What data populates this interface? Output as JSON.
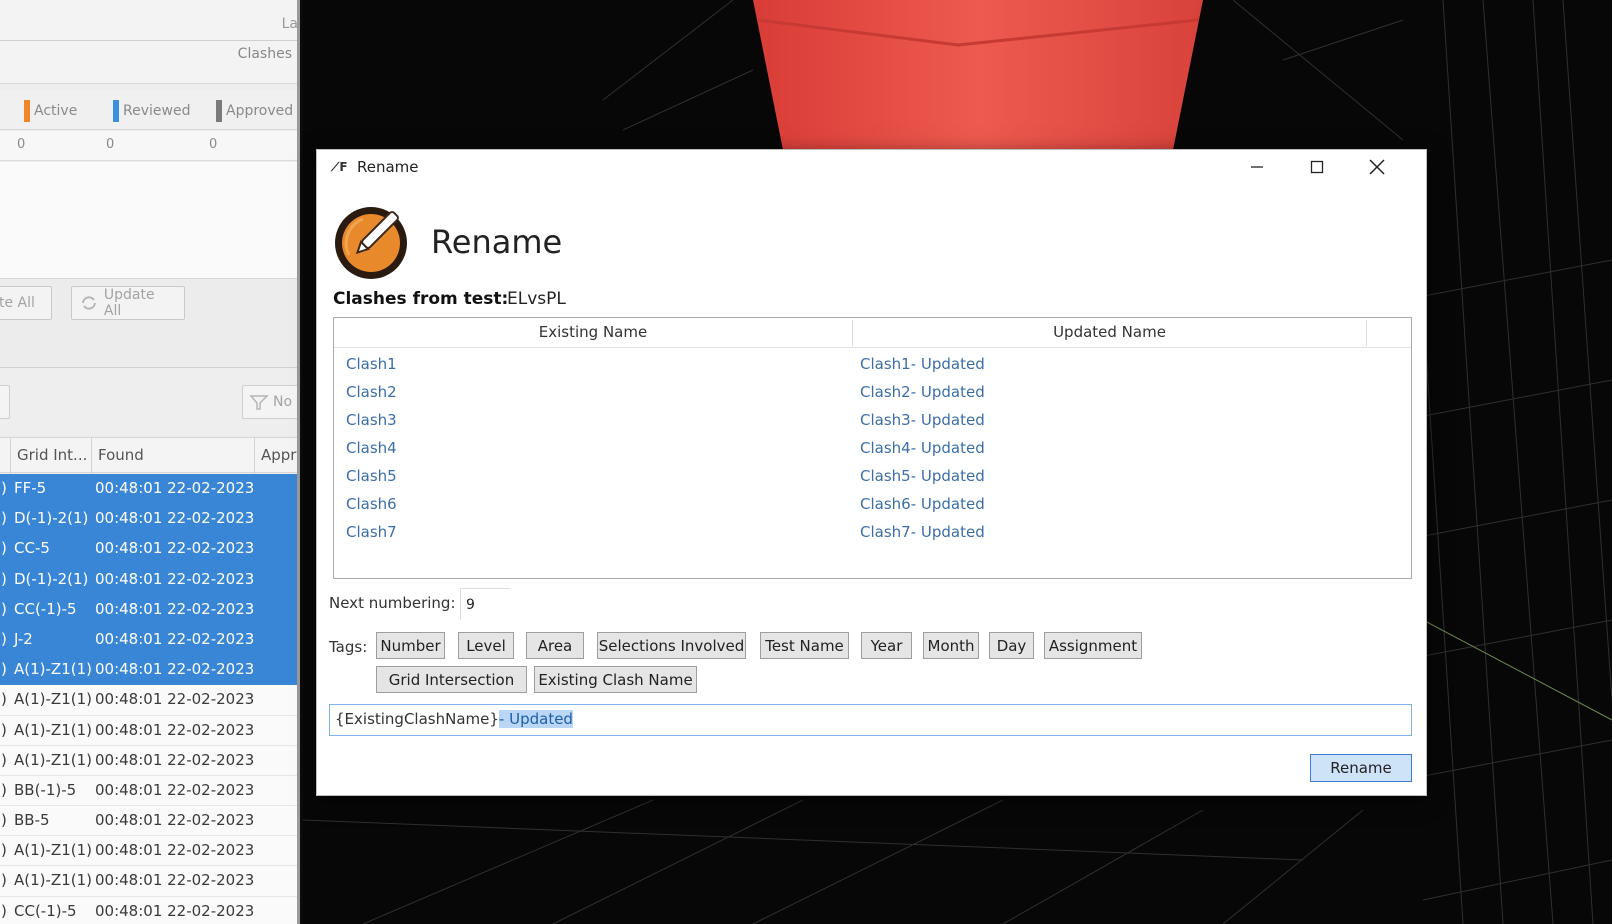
{
  "left_panel": {
    "top_truncated": "La",
    "clashes_label": "Clashes",
    "statuses": [
      {
        "label": "Active",
        "color": "#f0862a"
      },
      {
        "label": "Reviewed",
        "color": "#3b8ee0"
      },
      {
        "label": "Approved",
        "color": "#7a7a7a"
      }
    ],
    "counts": [
      "0",
      "0",
      "0"
    ],
    "buttons": {
      "reset_all": "te All",
      "update_all": "Update All"
    },
    "toolbar": {
      "right_button": "No"
    },
    "columns": {
      "grid_int": "Grid Int...",
      "found": "Found",
      "approved": "Appr"
    },
    "rows": [
      {
        "grid": "FF-5",
        "found": "00:48:01 22-02-2023",
        "selected": true
      },
      {
        "grid": "D(-1)-2(1)",
        "found": "00:48:01 22-02-2023",
        "selected": true
      },
      {
        "grid": "CC-5",
        "found": "00:48:01 22-02-2023",
        "selected": true
      },
      {
        "grid": "D(-1)-2(1)",
        "found": "00:48:01 22-02-2023",
        "selected": true
      },
      {
        "grid": "CC(-1)-5",
        "found": "00:48:01 22-02-2023",
        "selected": true
      },
      {
        "grid": "J-2",
        "found": "00:48:01 22-02-2023",
        "selected": true
      },
      {
        "grid": "A(1)-Z1(1)",
        "found": "00:48:01 22-02-2023",
        "selected": true
      },
      {
        "grid": "A(1)-Z1(1)",
        "found": "00:48:01 22-02-2023",
        "selected": false
      },
      {
        "grid": "A(1)-Z1(1)",
        "found": "00:48:01 22-02-2023",
        "selected": false
      },
      {
        "grid": "A(1)-Z1(1)",
        "found": "00:48:01 22-02-2023",
        "selected": false
      },
      {
        "grid": "BB(-1)-5",
        "found": "00:48:01 22-02-2023",
        "selected": false
      },
      {
        "grid": "BB-5",
        "found": "00:48:01 22-02-2023",
        "selected": false
      },
      {
        "grid": "A(1)-Z1(1)",
        "found": "00:48:01 22-02-2023",
        "selected": false
      },
      {
        "grid": "A(1)-Z1(1)",
        "found": "00:48:01 22-02-2023",
        "selected": false
      },
      {
        "grid": "CC(-1)-5",
        "found": "00:48:01 22-02-2023",
        "selected": false
      }
    ],
    "row_prefix": ")"
  },
  "dialog": {
    "window_title": "Rename",
    "heading": "Rename",
    "clashes_from_label": "Clashes from test:",
    "test_name": "ELvsPL",
    "columns": {
      "existing": "Existing Name",
      "updated": "Updated Name"
    },
    "rows": [
      {
        "existing": "Clash1",
        "updated": "Clash1- Updated"
      },
      {
        "existing": "Clash2",
        "updated": "Clash2- Updated"
      },
      {
        "existing": "Clash3",
        "updated": "Clash3- Updated"
      },
      {
        "existing": "Clash4",
        "updated": "Clash4- Updated"
      },
      {
        "existing": "Clash5",
        "updated": "Clash5- Updated"
      },
      {
        "existing": "Clash6",
        "updated": "Clash6- Updated"
      },
      {
        "existing": "Clash7",
        "updated": "Clash7- Updated"
      }
    ],
    "next_numbering_label": "Next numbering:",
    "next_numbering_value": "9",
    "tags_label": "Tags:",
    "tags": [
      "Number",
      "Level",
      "Area",
      "Selections Involved",
      "Test Name",
      "Year",
      "Month",
      "Day",
      "Assignment",
      "Grid Intersection",
      "Existing Clash Name"
    ],
    "pattern_prefix": "{ExistingClashName}",
    "pattern_selected": "- Updated",
    "rename_button": "Rename"
  },
  "colors": {
    "selection_blue": "#3a86d6",
    "logo_orange": "#e8892b",
    "red_object": "#e0483f"
  }
}
